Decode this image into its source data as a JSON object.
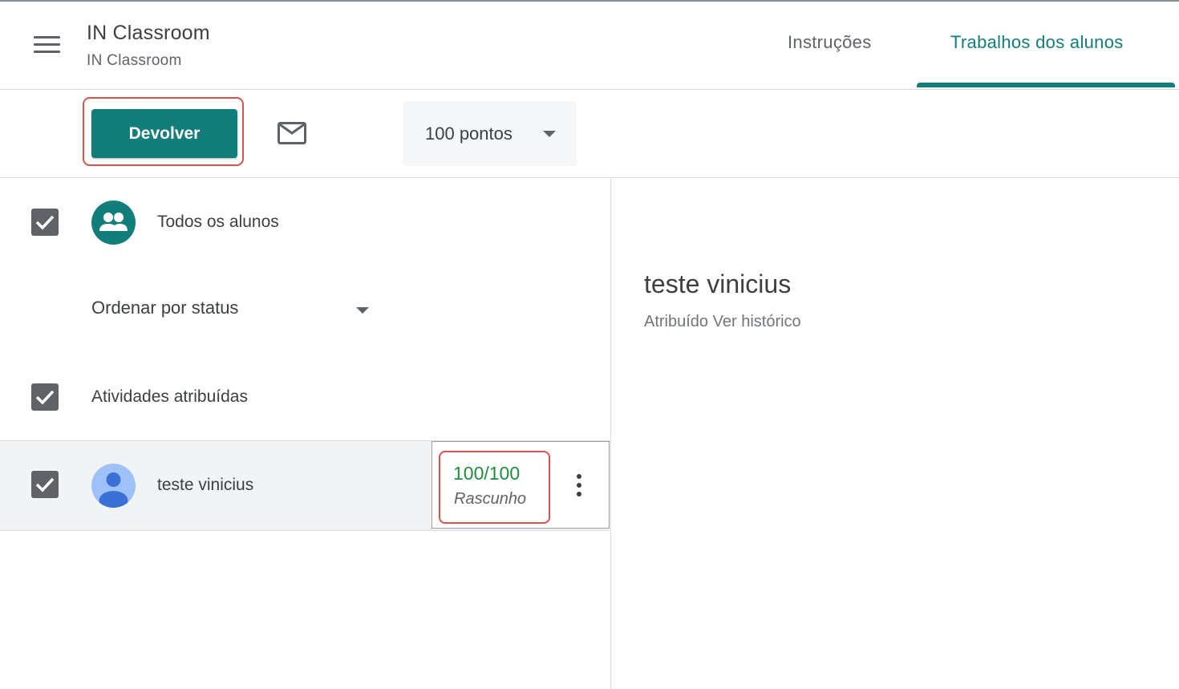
{
  "header": {
    "app_title": "IN Classroom",
    "app_subtitle": "IN Classroom",
    "tabs": [
      {
        "label": "Instruções",
        "active": false
      },
      {
        "label": "Trabalhos dos alunos",
        "active": true
      }
    ]
  },
  "toolbar": {
    "return_label": "Devolver",
    "points_value": "100 pontos"
  },
  "left_panel": {
    "all_students_label": "Todos os alunos",
    "sort_label": "Ordenar por status",
    "assigned_section_label": "Atividades atribuídas",
    "students": [
      {
        "name": "teste vinicius",
        "grade": "100/100",
        "status": "Rascunho",
        "checked": true
      }
    ]
  },
  "right_panel": {
    "student_name": "teste vinicius",
    "status": "Atribuído",
    "history_link": "Ver histórico"
  },
  "colors": {
    "accent": "#137d7a",
    "grade_green": "#1e8e3e",
    "highlight_red": "#d9534a"
  },
  "icons": [
    "menu-icon",
    "mail-icon",
    "people-icon",
    "person-icon",
    "more-vert-icon",
    "check-icon",
    "chevron-down-icon"
  ]
}
